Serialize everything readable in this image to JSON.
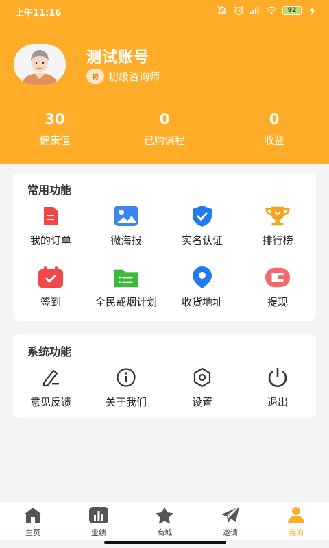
{
  "status_bar": {
    "time": "上午11:16",
    "battery": "92"
  },
  "profile": {
    "name": "测试账号",
    "role_badge": "初",
    "role": "初级咨询师"
  },
  "stats": [
    {
      "value": "30",
      "label": "健康值"
    },
    {
      "value": "0",
      "label": "已购课程"
    },
    {
      "value": "0",
      "label": "收益"
    }
  ],
  "common": {
    "title": "常用功能",
    "items": [
      {
        "label": "我的订单",
        "icon": "order-icon"
      },
      {
        "label": "微海报",
        "icon": "poster-icon"
      },
      {
        "label": "实名认证",
        "icon": "shield-check-icon"
      },
      {
        "label": "排行榜",
        "icon": "trophy-icon"
      },
      {
        "label": "签到",
        "icon": "calendar-check-icon"
      },
      {
        "label": "全民戒烟计划",
        "icon": "folder-list-icon"
      },
      {
        "label": "收货地址",
        "icon": "location-pin-icon"
      },
      {
        "label": "提现",
        "icon": "wallet-icon"
      }
    ]
  },
  "system": {
    "title": "系统功能",
    "items": [
      {
        "label": "意见反馈",
        "icon": "feedback-edit-icon"
      },
      {
        "label": "关于我们",
        "icon": "info-icon"
      },
      {
        "label": "设置",
        "icon": "settings-hex-icon"
      },
      {
        "label": "退出",
        "icon": "power-icon"
      }
    ]
  },
  "nav": [
    {
      "label": "主页",
      "icon": "home-icon"
    },
    {
      "label": "业绩",
      "icon": "bar-chart-icon"
    },
    {
      "label": "商城",
      "icon": "star-icon"
    },
    {
      "label": "邀请",
      "icon": "paper-plane-icon"
    },
    {
      "label": "我的",
      "icon": "user-icon"
    }
  ],
  "colors": {
    "accent": "#ffad28",
    "background": "#f3f4f6",
    "card": "#ffffff"
  }
}
